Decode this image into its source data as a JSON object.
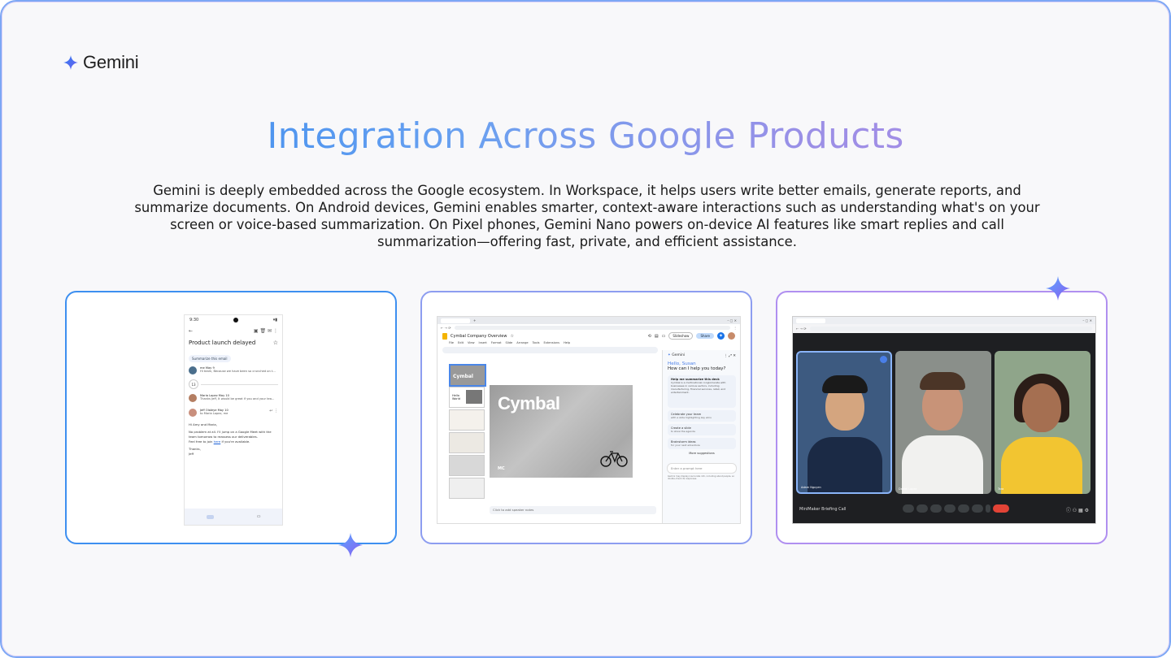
{
  "brand": {
    "name": "Gemini"
  },
  "heading": "Integration Across Google Products",
  "description": "Gemini is deeply embedded across the Google ecosystem. In Workspace, it helps users write better emails, generate reports, and summarize documents. On Android devices, Gemini enables smarter, context-aware interactions such as understanding what's on your screen or voice-based summarization. On Pixel phones, Gemini Nano powers on-device AI features like smart replies and call summarization—offering fast, private, and efficient assistance.",
  "gmail": {
    "time": "9:30",
    "subject": "Product launch delayed",
    "summarize_chip": "Summarize this email",
    "collapsed_count": "13",
    "messages": [
      {
        "sender": "me",
        "date": "May 9",
        "snippet": "Hi team, Because we have been so crunched on t..."
      },
      {
        "sender": "Maria Lopez",
        "date": "May 10",
        "snippet": "Thanks Jeff, It would be great if you and your tea..."
      },
      {
        "sender": "Jeff Olaleye",
        "date": "May 10",
        "snippet": "to Maria Lopez, me"
      }
    ],
    "body": {
      "greeting": "Hi Amy and Maria,",
      "line1": "No problem at all. I'll jump on a Google Meet with the team tomorrow to reassess our deliverables.",
      "line2_pre": "Feel free to join ",
      "link": "here",
      "line2_post": " if you're available.",
      "signoff": "Thanks,",
      "name": "Jeff"
    }
  },
  "slides": {
    "doc_title": "Cymbal Company Overview",
    "menu": [
      "File",
      "Edit",
      "View",
      "Insert",
      "Format",
      "Slide",
      "Arrange",
      "Tools",
      "Extensions",
      "Help"
    ],
    "slideshow_label": "Slideshow",
    "share_label": "Share",
    "main_slide_text": "Cymbal",
    "logo_text": "MC",
    "thumb_hello": "Hello World",
    "speaker_notes": "Click to add speaker notes",
    "gemini_panel": {
      "title": "Gemini",
      "hello": "Hello, Susan",
      "question": "How can I help you today?",
      "suggestion_main": "Help me summarize this deck",
      "suggestion_main_text": "Cymbal is a multinational conglomerate with businesses in various sectors, including manufacturing, financial services, retail, and entertainment.",
      "suggestions": [
        {
          "title": "Celebrate your team",
          "sub": "with a slide highlighting key wins"
        },
        {
          "title": "Create a slide",
          "sub": "to show the agenda"
        },
        {
          "title": "Brainstorm ideas",
          "sub": "for your next adventure"
        }
      ],
      "more": "More suggestions",
      "prompt_placeholder": "Enter a prompt here",
      "disclaimer": "Gemini may display inaccurate info, including about people, so double-check its responses."
    }
  },
  "meet": {
    "call_name": "MiniMaker Briefing Call",
    "participants": [
      "Adam Nguyen",
      "Daniel Lopez",
      "Tara"
    ]
  }
}
